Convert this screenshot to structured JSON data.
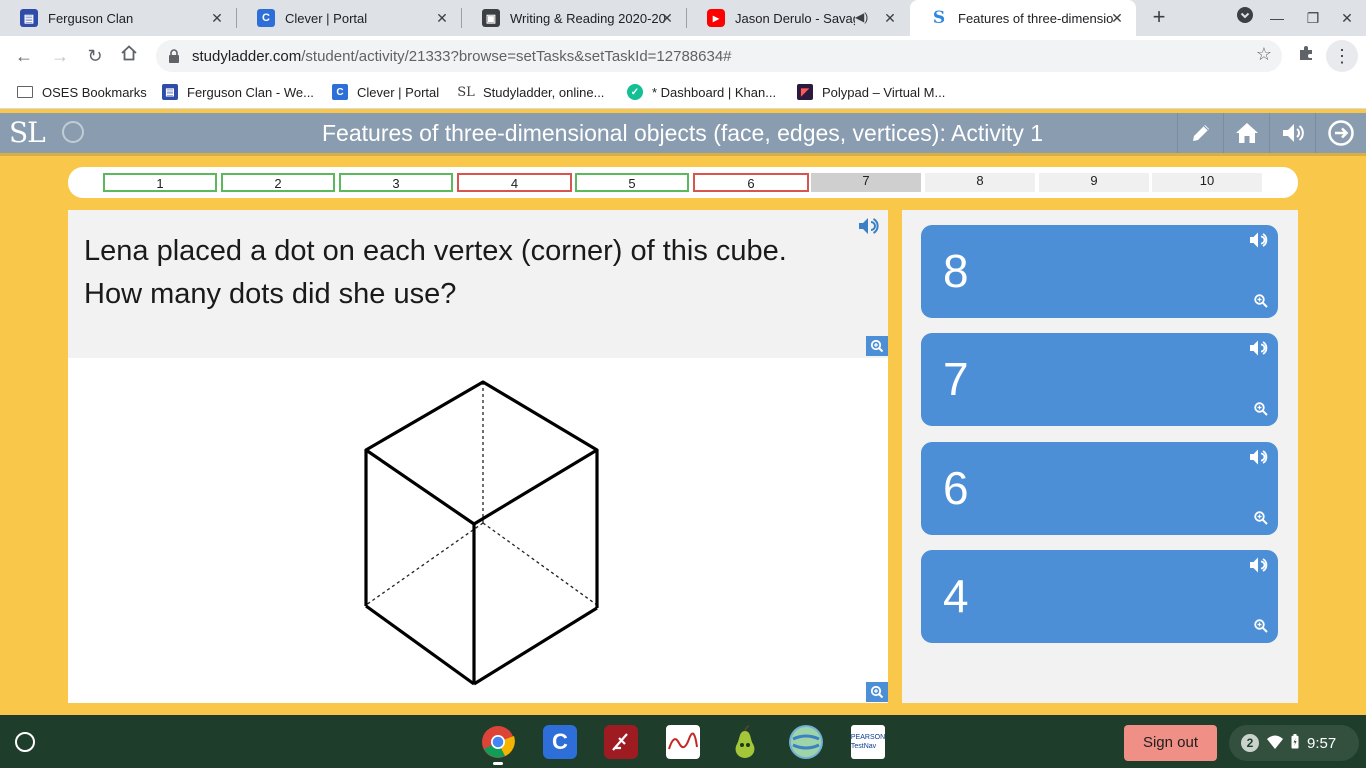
{
  "browser": {
    "tabs": [
      {
        "title": "Ferguson Clan",
        "favicon": "ferguson-clan-favicon",
        "active": false
      },
      {
        "title": "Clever | Portal",
        "favicon": "clever-favicon",
        "active": false
      },
      {
        "title": "Writing & Reading 2020-20",
        "favicon": "writing-reading-favicon",
        "active": false
      },
      {
        "title": "Jason Derulo - Savage",
        "favicon": "youtube-favicon",
        "active": false,
        "audio": true
      },
      {
        "title": "Features of three-dimensio",
        "favicon": "studyladder-favicon",
        "active": true
      }
    ],
    "new_tab": "+",
    "address": {
      "host": "studyladder.com",
      "path": "/student/activity/21333?browse=setTasks&setTaskId=12788634#"
    },
    "bookmarks": [
      {
        "label": "OSES Bookmarks",
        "icon": "folder-icon"
      },
      {
        "label": "Ferguson Clan - We...",
        "icon": "ferguson-clan-favicon"
      },
      {
        "label": "Clever | Portal",
        "icon": "clever-favicon"
      },
      {
        "label": "Studyladder, online...",
        "icon": "studyladder-favicon"
      },
      {
        "label": "* Dashboard | Khan...",
        "icon": "khan-favicon"
      },
      {
        "label": "Polypad – Virtual M...",
        "icon": "polypad-favicon"
      }
    ]
  },
  "site": {
    "logo": "SL",
    "title": "Features of three-dimensional objects (face, edges, vertices): Activity 1",
    "header_buttons": [
      "pencil-icon",
      "home-icon",
      "speaker-icon",
      "exit-icon"
    ]
  },
  "progress": {
    "cells": [
      {
        "label": "1",
        "state": "correct"
      },
      {
        "label": "2",
        "state": "correct"
      },
      {
        "label": "3",
        "state": "correct"
      },
      {
        "label": "4",
        "state": "wrong"
      },
      {
        "label": "5",
        "state": "correct"
      },
      {
        "label": "6",
        "state": "wrong"
      },
      {
        "label": "7",
        "state": "current"
      },
      {
        "label": "8",
        "state": "pending"
      },
      {
        "label": "9",
        "state": "pending"
      },
      {
        "label": "10",
        "state": "pending"
      }
    ]
  },
  "question": {
    "line1": "Lena placed a dot on each vertex (corner) of this cube.",
    "line2": "How many dots did she use?"
  },
  "answers": [
    {
      "value": "8"
    },
    {
      "value": "7"
    },
    {
      "value": "6"
    },
    {
      "value": "4"
    }
  ],
  "taskbar": {
    "apps": [
      "chrome-icon",
      "clever-icon",
      "app-red-icon",
      "graph-app-icon",
      "pear-deck-icon",
      "globe-app-icon",
      "testnav-icon"
    ],
    "testnav_label": "PEARSON TestNav",
    "sign_out": "Sign out",
    "notifications": "2",
    "time": "9:57"
  },
  "colors": {
    "page_bg": "#f9c84a",
    "header_bg": "#8a9db0",
    "answer_bg": "#4d8fd6",
    "correct_border": "#5cb85c",
    "wrong_border": "#d9534f",
    "taskbar_bg": "#1f3d2b",
    "signout_bg": "#ef8f86"
  }
}
